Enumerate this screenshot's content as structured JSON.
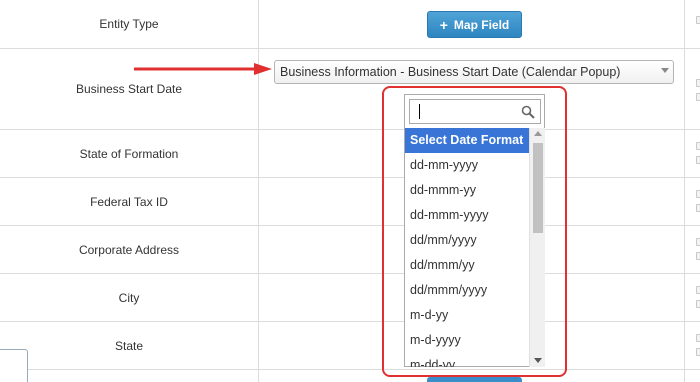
{
  "rows": [
    {
      "label": "Entity Type"
    },
    {
      "label": "Business Start Date"
    },
    {
      "label": "State of Formation"
    },
    {
      "label": "Federal Tax ID"
    },
    {
      "label": "Corporate Address"
    },
    {
      "label": "City"
    },
    {
      "label": "State"
    }
  ],
  "map_field_button": {
    "label": "Map Field",
    "icon": "plus-icon"
  },
  "field_select": {
    "selected": "Business Information - Business Start Date (Calendar Popup)"
  },
  "dropdown": {
    "search_value": "",
    "options": [
      "Select Date Format",
      "dd-mm-yyyy",
      "dd-mmm-yy",
      "dd-mmm-yyyy",
      "dd/mm/yyyy",
      "dd/mmm/yy",
      "dd/mmm/yyyy",
      "m-d-yy",
      "m-d-yyyy",
      "m-dd-yy"
    ],
    "selected_option": "Select Date Format"
  },
  "colors": {
    "accent": "#3875d7",
    "button": "#2e86c1",
    "annotation": "#e03030"
  }
}
